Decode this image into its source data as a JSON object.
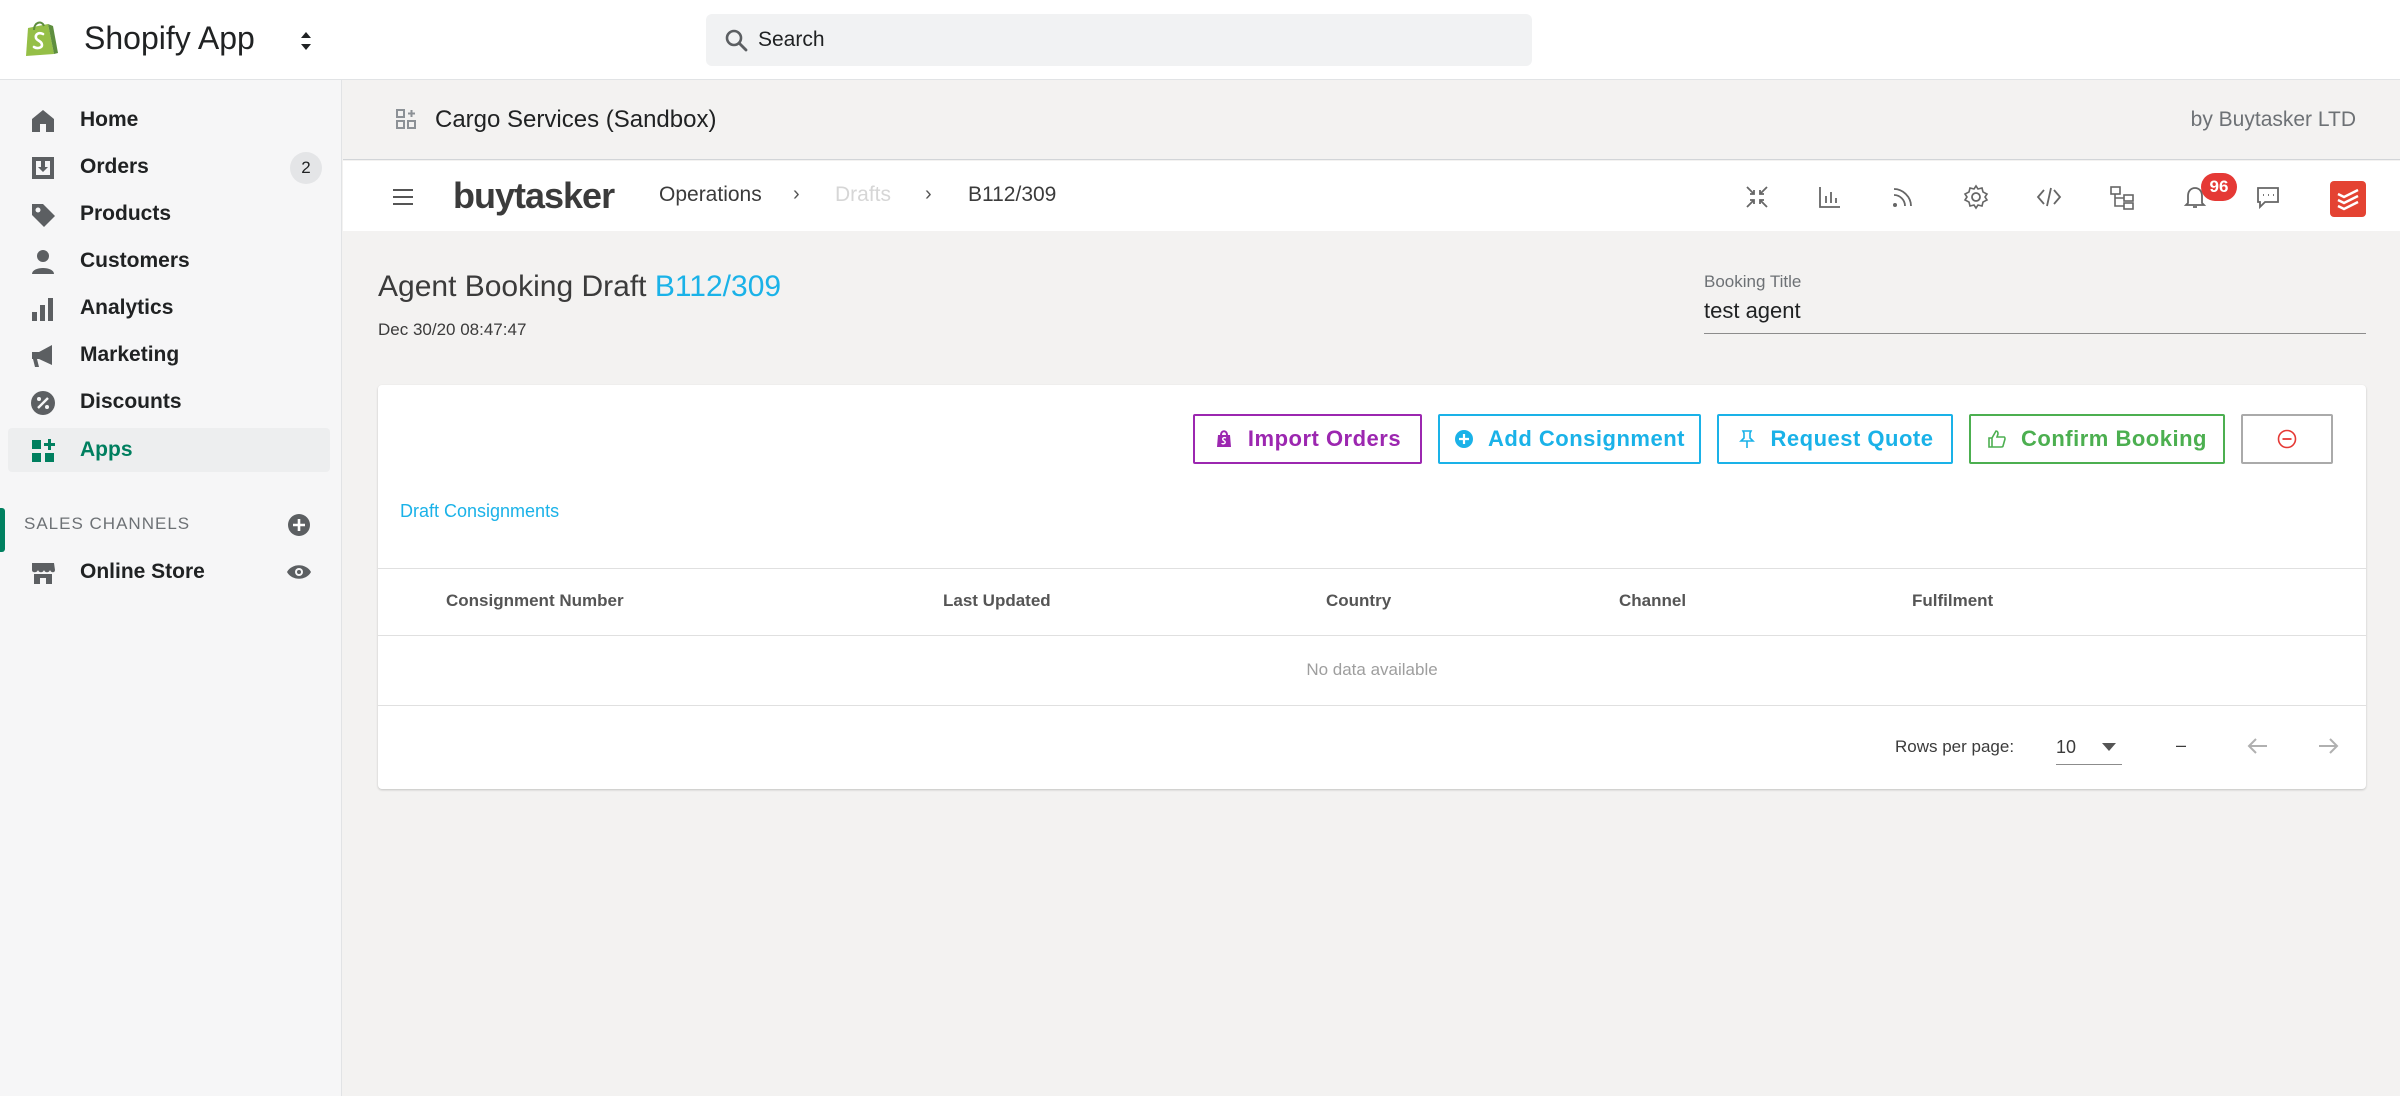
{
  "topbar": {
    "app_title": "Shopify App",
    "search_placeholder": "Search"
  },
  "sidebar": {
    "items": [
      {
        "label": "Home",
        "icon": "home-icon"
      },
      {
        "label": "Orders",
        "icon": "orders-icon",
        "badge": "2"
      },
      {
        "label": "Products",
        "icon": "tag-icon"
      },
      {
        "label": "Customers",
        "icon": "person-icon"
      },
      {
        "label": "Analytics",
        "icon": "bar-chart-icon"
      },
      {
        "label": "Marketing",
        "icon": "megaphone-icon"
      },
      {
        "label": "Discounts",
        "icon": "discount-icon"
      },
      {
        "label": "Apps",
        "icon": "apps-icon",
        "active": true
      }
    ],
    "sales_channels_label": "SALES CHANNELS",
    "online_store_label": "Online Store"
  },
  "app_header": {
    "name": "Cargo Services (Sandbox)",
    "by": "by Buytasker LTD"
  },
  "bt_nav": {
    "logo": "buytasker",
    "breadcrumb": [
      "Operations",
      "Drafts",
      "B112/309"
    ],
    "notification_count": "96",
    "icons": [
      "collapse-icon",
      "chart-icon",
      "feed-icon",
      "settings-icon",
      "code-icon",
      "sitemap-icon",
      "bell-icon",
      "chat-icon",
      "todoist-icon"
    ]
  },
  "draft": {
    "title_prefix": "Agent Booking Draft",
    "title_id": "B112/309",
    "date": "Dec 30/20 08:47:47",
    "booking_title_label": "Booking Title",
    "booking_title_value": "test agent"
  },
  "actions": {
    "import_orders": "Import Orders",
    "add_consignment": "Add Consignment",
    "request_quote": "Request Quote",
    "confirm_booking": "Confirm Booking"
  },
  "table": {
    "tab_label": "Draft Consignments",
    "columns": [
      "Consignment Number",
      "Last Updated",
      "Country",
      "Channel",
      "Fulfilment"
    ],
    "empty_text": "No data available",
    "rows_per_page_label": "Rows per page:",
    "rows_per_page_value": "10",
    "page_range": "–"
  },
  "colors": {
    "shopify_green": "#95bf47",
    "active_green": "#007f5f",
    "bt_blue": "#1ab2e8",
    "import_purple": "#9c27b0",
    "confirm_green": "#4caf50",
    "danger_red": "#e53935"
  }
}
